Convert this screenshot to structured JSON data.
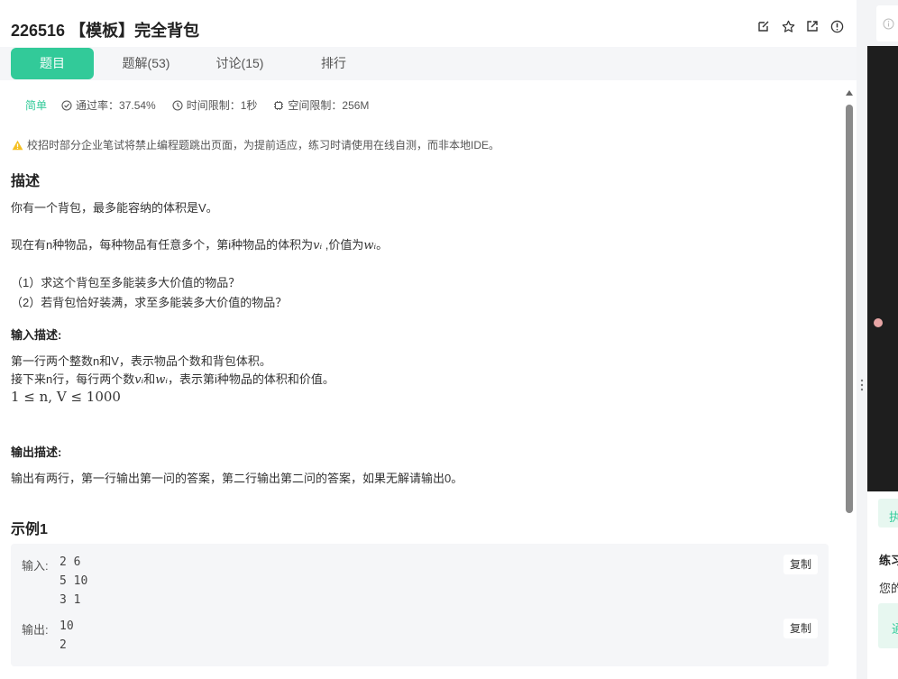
{
  "problem": {
    "title": "226516 【模板】完全背包"
  },
  "tabs": [
    {
      "label": "题目"
    },
    {
      "label": "题解(53)"
    },
    {
      "label": "讨论(15)"
    },
    {
      "label": "排行"
    }
  ],
  "meta": {
    "difficulty": "简单",
    "pass_rate": "通过率：37.54%",
    "time_limit": "时间限制：1秒",
    "space_limit": "空间限制：256M"
  },
  "notice": "校招时部分企业笔试将禁止编程题跳出页面，为提前适应，练习时请使用在线自测，而非本地IDE。",
  "description": {
    "heading": "描述",
    "line1": "你有一个背包，最多能容纳的体积是V。",
    "line2_a": "现在有n种物品，每种物品有任意多个，第i种物品的体积为",
    "line2_v": "vᵢ",
    "line2_b": " ,价值为",
    "line2_w": "wᵢ",
    "line2_c": "。",
    "line3": "（1）求这个背包至多能装多大价值的物品？",
    "line4": "（2）若背包恰好装满，求至多能装多大价值的物品？"
  },
  "input_desc": {
    "heading": "输入描述:",
    "line1": "第一行两个整数n和V，表示物品个数和背包体积。",
    "line2_a": "接下来n行，每行两个数",
    "line2_v": "vᵢ",
    "line2_b": "和",
    "line2_w": "wᵢ",
    "line2_c": "，表示第i种物品的体积和价值。",
    "constraint": "1 ≤ n, V ≤ 1000"
  },
  "output_desc": {
    "heading": "输出描述:",
    "line1": "输出有两行，第一行输出第一问的答案，第二行输出第二问的答案，如果无解请输出0。"
  },
  "example": {
    "heading": "示例1",
    "input_label": "输入:",
    "input_code": "2 6\n5 10\n3 1",
    "output_label": "输出:",
    "output_code": "10\n2",
    "copy_label": "复制"
  },
  "right_panel": {
    "top_icon": "info-icon",
    "green_button": "执",
    "section_title": "练习",
    "section_text": "您的",
    "link_button": "通"
  },
  "colors": {
    "accent": "#32ca99",
    "warning": "#f5c022"
  }
}
